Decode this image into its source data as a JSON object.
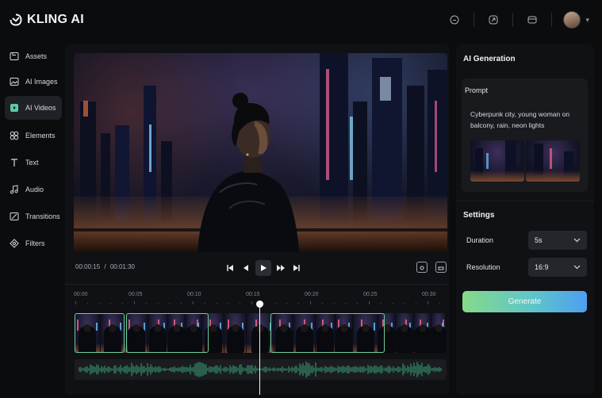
{
  "app": {
    "title": "KLING AI"
  },
  "sidebar": {
    "items": [
      {
        "label": "Assets",
        "icon": "folder-icon"
      },
      {
        "label": "AI Images",
        "icon": "image-icon"
      },
      {
        "label": "AI Videos",
        "icon": "video-icon",
        "active": true
      },
      {
        "label": "Elements",
        "icon": "elements-icon"
      },
      {
        "label": "Text",
        "icon": "text-icon"
      },
      {
        "label": "Audio",
        "icon": "music-note-icon"
      },
      {
        "label": "Transitions",
        "icon": "transitions-icon"
      },
      {
        "label": "Filters",
        "icon": "filters-icon"
      }
    ]
  },
  "header": {
    "icons": [
      "tiktok-icon",
      "share-icon",
      "notification-icon"
    ]
  },
  "player": {
    "current_time": "00:00:15",
    "separator": "/",
    "total_time": "00:01:30"
  },
  "timeline": {
    "ticks": [
      "00:00",
      "00:05",
      "00:10",
      "00:15",
      "00:20",
      "00:25",
      "00:30"
    ],
    "playhead_seconds": 15
  },
  "panel": {
    "title": "AI Generation",
    "prompt_label": "Prompt",
    "prompt_text": "Cyberpunk city, young woman on balcony, rain, neon lights",
    "settings_title": "Settings",
    "duration_label": "Duration",
    "duration_value": "5s",
    "resolution_label": "Resolution",
    "resolution_value": "16:9",
    "generate_label": "Generate"
  },
  "colors": {
    "accent_green": "#6fcf97",
    "generate_gradient_start": "#86d98a",
    "generate_gradient_end": "#4e9ff0"
  }
}
